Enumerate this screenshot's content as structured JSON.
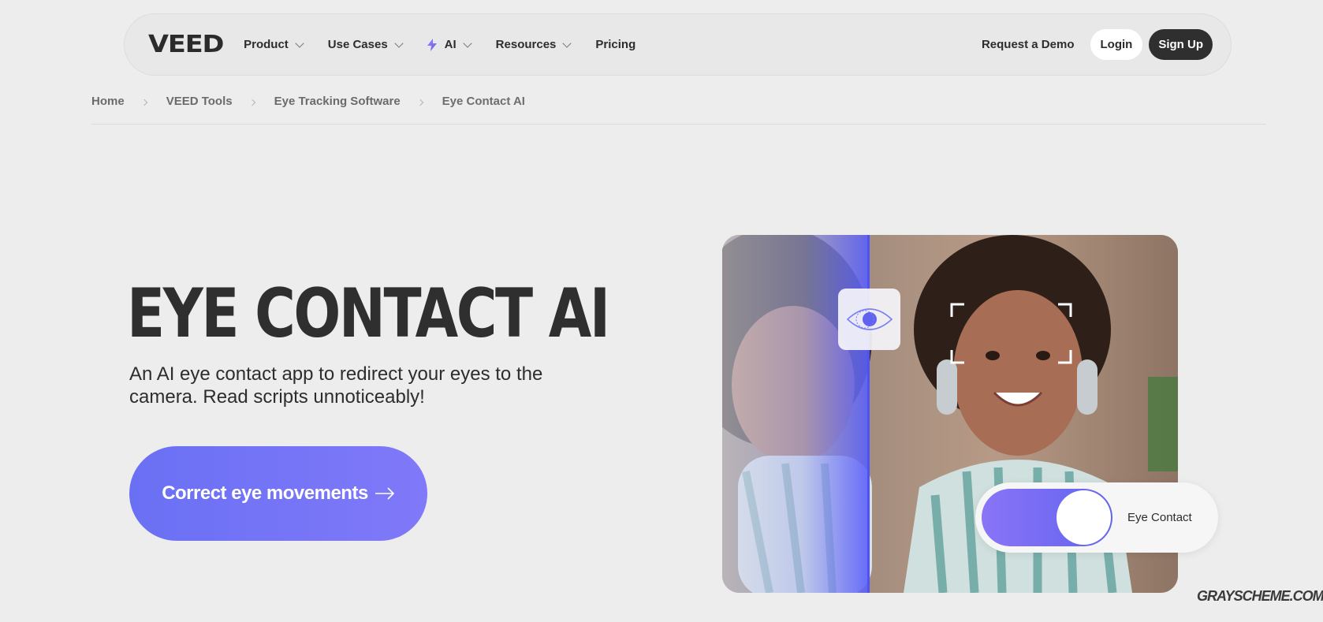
{
  "brand": {
    "logo": "VEED"
  },
  "nav": {
    "items": [
      {
        "label": "Product",
        "dropdown": true
      },
      {
        "label": "Use Cases",
        "dropdown": true
      },
      {
        "label": "AI",
        "dropdown": true,
        "icon": "lightning-icon"
      },
      {
        "label": "Resources",
        "dropdown": true
      },
      {
        "label": "Pricing",
        "dropdown": false
      }
    ],
    "request_demo": "Request a Demo",
    "login": "Login",
    "signup": "Sign Up"
  },
  "breadcrumb": [
    "Home",
    "VEED Tools",
    "Eye Tracking Software",
    "Eye Contact AI"
  ],
  "hero": {
    "title": "EYE CONTACT AI",
    "subtitle": "An AI eye contact app to redirect your eyes to the camera. Read scripts unnoticeably!",
    "cta": "Correct eye movements"
  },
  "visual": {
    "toggle_label": "Eye Contact",
    "toggle_on": true
  },
  "watermark": "GRAYSCHEME.COM",
  "colors": {
    "accent": "#6a70f4",
    "accent_light": "#8079f9",
    "background": "#ecedec",
    "dark": "#2f2f2f"
  }
}
